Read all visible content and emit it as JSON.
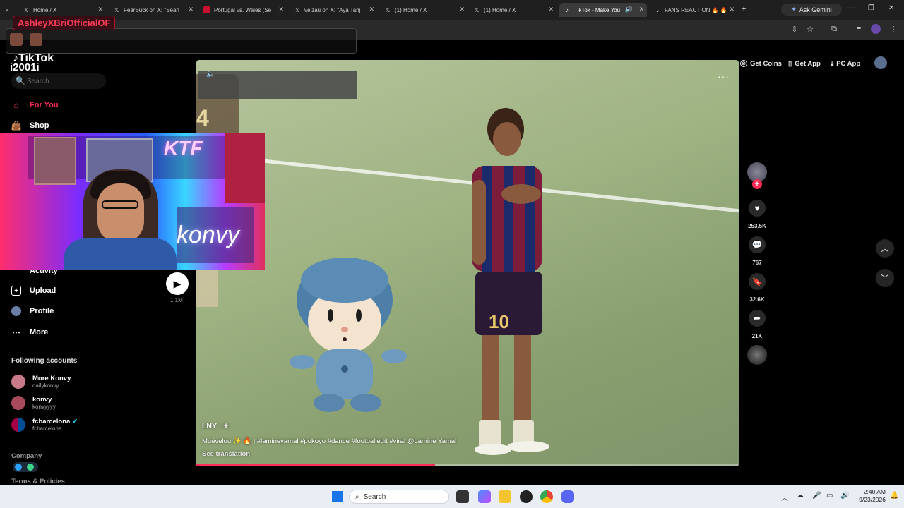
{
  "browser": {
    "tabs": [
      {
        "title": "Home / X",
        "icon": "x-logo-icon"
      },
      {
        "title": "FearBuck on X: \"Sean",
        "icon": "x-logo-icon"
      },
      {
        "title": "Portugal vs. Wales (Se",
        "icon": "red-logo-icon"
      },
      {
        "title": "veizau on X: \"Aya Tanj",
        "icon": "x-logo-icon"
      },
      {
        "title": "(1) Home / X",
        "icon": "x-logo-icon"
      },
      {
        "title": "(1) Home / X",
        "icon": "x-logo-icon"
      },
      {
        "title": "TikTok - Make You",
        "icon": "tiktok-icon",
        "active": true
      },
      {
        "title": "FANS REACTION 🔥 🔥",
        "icon": "tiktok-icon"
      }
    ],
    "ask_gemini": "Ask Gemini"
  },
  "stream_overlay": {
    "name": "AshleyXBriOfficialOF",
    "counter": "i2001i"
  },
  "sidebar": {
    "logo": "TikTok",
    "search_placeholder": "Search",
    "nav": [
      {
        "label": "For You",
        "icon": "home-icon",
        "active": true
      },
      {
        "label": "Shop",
        "icon": "shop-bag-icon"
      },
      {
        "label": "Activity",
        "icon": "bell-icon"
      },
      {
        "label": "Upload",
        "icon": "plus-square-icon"
      },
      {
        "label": "Profile",
        "icon": "avatar-icon"
      },
      {
        "label": "More",
        "icon": "ellipsis-icon"
      }
    ],
    "following_title": "Following accounts",
    "following": [
      {
        "name": "More Konvy",
        "handle": "dailykonvy"
      },
      {
        "name": "konvy",
        "handle": "konvyyyy"
      },
      {
        "name": "fcbarcelona",
        "handle": "fcbarcelona",
        "verified": true
      }
    ],
    "footer": {
      "company": "Company",
      "terms": "Terms & Policies"
    },
    "play_count": "1.1M"
  },
  "header": {
    "get_coins": "Get Coins",
    "get_app": "Get App",
    "pc_app": "PC App"
  },
  "video": {
    "author": "LNY",
    "caption": "Muévelou ✨ 🔥 | #lamineyamal #pokoyo #dance #footballedit #viral @Lamine Yamal",
    "see_translation": "See translation",
    "jersey_number": "10",
    "bg_jersey_number": "4",
    "progress": 0.44
  },
  "actions": {
    "likes": "253.5K",
    "comments": "767",
    "saves": "32.6K",
    "shares": "21K"
  },
  "webcam": {
    "neon_text": "KTF",
    "neon_text2": "konvy"
  },
  "taskbar": {
    "search": "Search",
    "time": "2:40 AM",
    "date": "9/23/2026"
  }
}
